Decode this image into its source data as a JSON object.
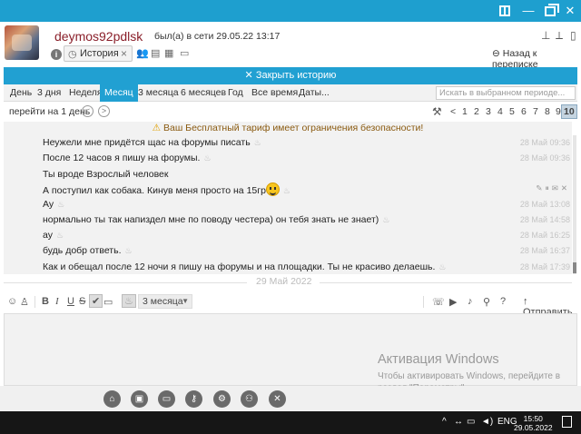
{
  "header": {
    "username": "deymos92pdlsk",
    "status": "был(а) в сети 29.05.22 13:17",
    "history_tab_label": "История",
    "back_link": "Назад к переписке"
  },
  "close_history_label": "✕ Закрыть историю",
  "period_tabs": [
    {
      "label": "День",
      "active": false
    },
    {
      "label": "3 дня",
      "active": false
    },
    {
      "label": "Неделя",
      "active": false
    },
    {
      "label": "Месяц",
      "active": true
    },
    {
      "label": "3 месяца",
      "active": false
    },
    {
      "label": "6 месяцев",
      "active": false
    },
    {
      "label": "Год",
      "active": false
    },
    {
      "label": "Все время",
      "active": false
    },
    {
      "label": "Даты...",
      "active": false
    }
  ],
  "search": {
    "placeholder": "Искать в выбранном периоде..."
  },
  "nav": {
    "goto_label": "перейти на 1 день",
    "pages": [
      "<",
      "1",
      "2",
      "3",
      "4",
      "5",
      "6",
      "7",
      "8",
      "9",
      "10"
    ],
    "current_page": "10"
  },
  "warning": "Ваш Бесплатный тариф имеет ограничения безопасности!",
  "messages": [
    {
      "text": "Неужели мне придётся щас на форумы писать",
      "time": "28 Май 09:36"
    },
    {
      "text": "После 12 часов я пишу на форумы.",
      "time": "28 Май 09:36"
    },
    {
      "text": "Ты вроде Взрослый человек",
      "time": ""
    },
    {
      "text": "А поступил как собака. Кинув меня просто на 15гр",
      "time": ""
    },
    {
      "text": "Ау",
      "time": "28 Май 13:08"
    },
    {
      "text": "нормально ты так напиздел мне по поводу честера) он тебя знать не знает)",
      "time": "28 Май 14:58"
    },
    {
      "text": "ау",
      "time": "28 Май 16:25"
    },
    {
      "text": "будь добр ответь.",
      "time": "28 Май 16:37"
    },
    {
      "text": "Как и обещал после 12 ночи я пишу на форумы и на площадки. Ты не красиво делаешь.",
      "time": "28 Май 17:39"
    }
  ],
  "date_separator": "29 Май 2022",
  "compose": {
    "format_buttons": [
      "B",
      "I",
      "U",
      "S"
    ],
    "period_value": "3 месяца",
    "send_label": "Отправить"
  },
  "watermark": {
    "title": "Активация Windows",
    "line1": "Чтобы активировать Windows, перейдите в",
    "line2": "раздел \"Параметры\"."
  },
  "taskbar": {
    "lang": "ENG",
    "time": "15:50",
    "date": "29.05.2022"
  },
  "icons": [
    "info-icon",
    "history-icon",
    "users-icon",
    "contact-card-icon",
    "calendar-icon",
    "file-icon",
    "back-arrow-icon",
    "tools-icon",
    "warning-icon",
    "fire-icon",
    "smile-icon",
    "person-icon",
    "phone-icon",
    "video-icon",
    "mic-icon",
    "attach-icon",
    "help-icon",
    "send-arrow-icon",
    "home-icon",
    "gear-icon",
    "key-icon"
  ]
}
